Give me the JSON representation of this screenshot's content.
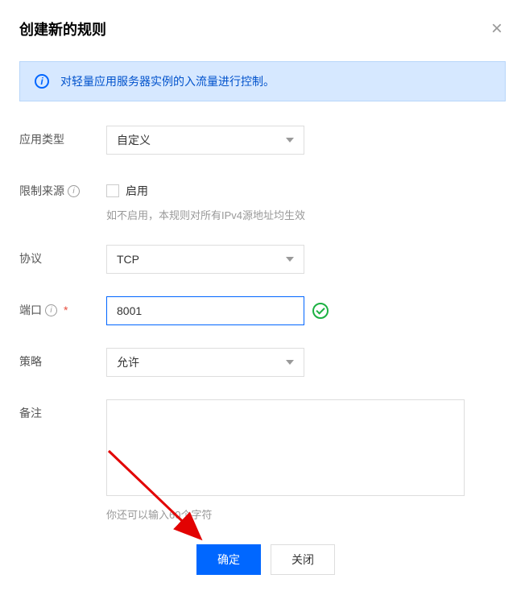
{
  "header": {
    "title": "创建新的规则"
  },
  "banner": {
    "text": "对轻量应用服务器实例的入流量进行控制。"
  },
  "form": {
    "appType": {
      "label": "应用类型",
      "value": "自定义"
    },
    "restrictSource": {
      "label": "限制来源",
      "checkboxLabel": "启用",
      "hint": "如不启用，本规则对所有IPv4源地址均生效"
    },
    "protocol": {
      "label": "协议",
      "value": "TCP"
    },
    "port": {
      "label": "端口",
      "value": "8001"
    },
    "policy": {
      "label": "策略",
      "value": "允许"
    },
    "remark": {
      "label": "备注",
      "hint": "你还可以输入60个字符"
    }
  },
  "footer": {
    "confirm": "确定",
    "cancel": "关闭"
  }
}
